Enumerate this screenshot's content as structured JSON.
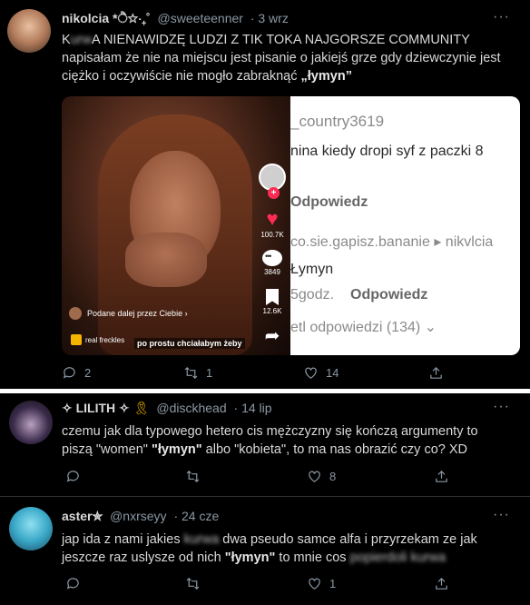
{
  "tweet1": {
    "name": "nikolcia *ੈ✩‧₊˚",
    "handle": "@sweeteenner",
    "time": "· 3 wrz",
    "text_line1_prefix": "K",
    "text_line1_censored": "urw",
    "text_line1_suffix": "A NIENAWIDZĘ LUDZI Z TIK TOKA NAJGORSZE COMMUNITY",
    "text_line2": "napisałam że nie na miejscu jest pisanie o jakiejś grze gdy dziewczynie jest",
    "text_line3_plain": "ciężko i oczywiście nie mogło zabraknąć ",
    "text_line3_bold": "„łymyn”",
    "more": "···",
    "replies": "2",
    "retweets": "1",
    "likes": "14",
    "media": {
      "video": {
        "likes": "100.7K",
        "comments": "3849",
        "saves": "12.6K",
        "shared_by": "Podane dalej przez Ciebie ›",
        "sound": "real freckles",
        "caption": "po prostu chciałabym żeby"
      },
      "comments": {
        "user1": "_country3619",
        "text1": "nina kiedy dropi syf z paczki 8",
        "reply1": "Odpowiedz",
        "thread": "co.sie.gapisz.bananie ▸ nikvlcia",
        "text2": "Łymyn",
        "time2": "5godz.",
        "reply2": "Odpowiedz",
        "view_more": "etl odpowiedzi (134) ⌄"
      }
    }
  },
  "tweet2": {
    "name": "✧ LILITH ✧",
    "handle": "@disckhead",
    "time": "· 14 lip",
    "text_line1": "czemu jak dla typowego hetero cis mężczyzny się kończą argumenty to",
    "text_line2_a": "piszą \"women\" ",
    "text_line2_b": "\"łymyn\"",
    "text_line2_c": " albo \"kobieta\", to ma nas obrazić czy co? XD",
    "more": "···",
    "replies": "",
    "retweets": "",
    "likes": "8"
  },
  "tweet3": {
    "name": "aster✮",
    "handle": "@nxrseyy",
    "time": "· 24 cze",
    "text_line1_a": "jap ida z nami jakies ",
    "text_line1_censored": "kurwa",
    "text_line1_b": " dwa pseudo samce alfa i przyrzekam ze jak",
    "text_line2_a": "jeszcze raz uslysze od nich ",
    "text_line2_b": "\"łymyn\"",
    "text_line2_c": " to mnie cos ",
    "text_line2_censored1": "popierdoli",
    "text_line2_censored2": "kurwa",
    "more": "···",
    "replies": "",
    "retweets": "",
    "likes": "1"
  },
  "colors": {
    "bg": "#000000",
    "text": "#d9d9d9",
    "muted": "#8b98a5",
    "divider": "#ffffff",
    "tiktok_red": "#fe2c55"
  }
}
